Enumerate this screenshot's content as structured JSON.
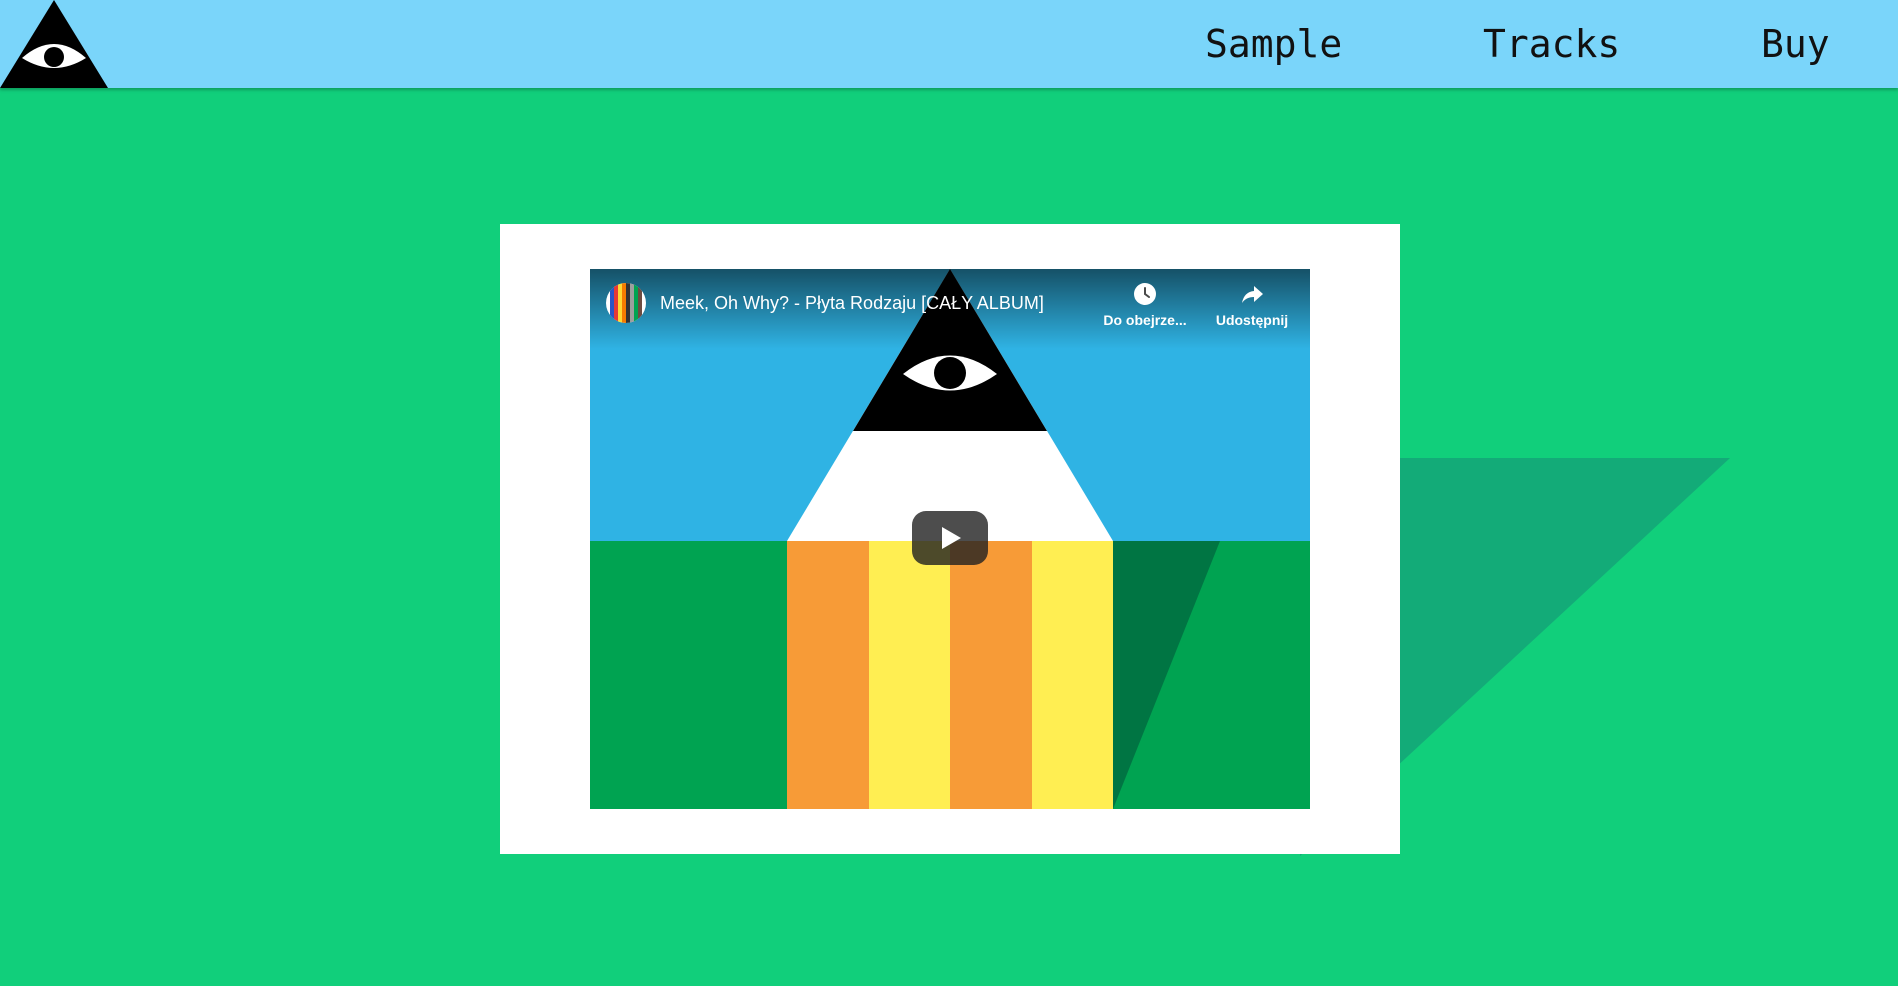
{
  "nav": {
    "logo_icon": "eye-in-triangle-icon",
    "links": [
      {
        "label": "Sample"
      },
      {
        "label": "Tracks"
      },
      {
        "label": "Buy"
      }
    ]
  },
  "colors": {
    "page_background": "#11cf7b",
    "nav_background": "#7ad5fa",
    "decor_triangle": "#13ab78",
    "frame": "#ffffff"
  },
  "video": {
    "title": "Meek, Oh Why? - Płyta Rodzaju [CAŁY ALBUM]",
    "watch_later_label": "Do obejrze...",
    "share_label": "Udostępnij",
    "play_icon": "play-icon",
    "watch_later_icon": "clock-icon",
    "share_icon": "share-arrow-icon",
    "channel_avatar_icon": "striped-colors-avatar"
  }
}
